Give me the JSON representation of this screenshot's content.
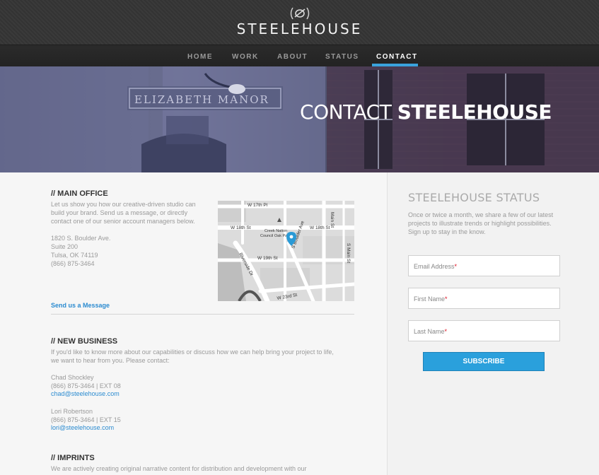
{
  "brand": {
    "name": "STEELEHOUSE"
  },
  "nav": {
    "items": [
      {
        "label": "HOME",
        "active": false
      },
      {
        "label": "WORK",
        "active": false
      },
      {
        "label": "ABOUT",
        "active": false
      },
      {
        "label": "STATUS",
        "active": false
      },
      {
        "label": "CONTACT",
        "active": true
      }
    ],
    "accent_color": "#3aa3dd"
  },
  "hero": {
    "title_light": "CONTACT",
    "title_bold": "STEELEHOUSE",
    "sign_text": "ELIZABETH MANOR"
  },
  "main_office": {
    "heading": "// MAIN OFFICE",
    "intro": [
      "Let us show you how our creative-driven studio can",
      "build your brand. Send us a message, or directly",
      "contact one of our senior account managers below."
    ],
    "address": [
      "1820 S. Boulder Ave.",
      "Suite 200",
      "Tulsa, OK 74119",
      "(866) 875-3464"
    ],
    "link": "Send us a Message"
  },
  "map": {
    "labels": [
      "W 17th Pl",
      "W 18th St",
      "W 18th St",
      "Creek Nation",
      "Council Oak Park",
      "W 19th St",
      "Riverside Dr",
      "S Boulder Ave",
      "W 23rd St",
      "Main St",
      "S Main St"
    ]
  },
  "new_business": {
    "heading": "// NEW BUSINESS",
    "intro": [
      "If you'd like to know more about our capabilities or discuss how we can help bring your project to life,",
      "we want to hear from you. Please contact:"
    ],
    "contacts": [
      {
        "name": "Chad Shockley",
        "phone": "(866) 875-3464 | EXT 08",
        "email": "chad@steelehouse.com"
      },
      {
        "name": "Lori Robertson",
        "phone": "(866) 875-3464 | EXT 15",
        "email": "lori@steelehouse.com"
      }
    ]
  },
  "imprints": {
    "heading": "// IMPRINTS",
    "intro": "We are actively creating original narrative content for distribution and development with our"
  },
  "status": {
    "title": "STEELEHOUSE STATUS",
    "text": [
      "Once or twice a month, we share a few of our latest",
      "projects to illustrate trends or highlight possibilities.",
      "Sign up to stay in the know."
    ],
    "fields": [
      {
        "placeholder": "Email Address"
      },
      {
        "placeholder": "First Name"
      },
      {
        "placeholder": "Last Name"
      }
    ],
    "required_mark": "*",
    "button": "SUBSCRIBE",
    "button_color": "#2aa0dc"
  }
}
